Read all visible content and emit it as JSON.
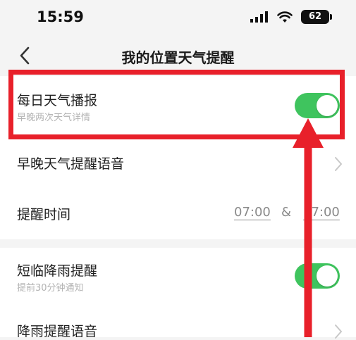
{
  "status_bar": {
    "time": "15:59",
    "battery": "62",
    "signal_icon": "signal-bars-icon",
    "wifi_icon": "wifi-icon"
  },
  "nav": {
    "title": "我的位置天气提醒",
    "back_icon": "chevron-left-icon"
  },
  "settings": {
    "daily_broadcast": {
      "title": "每日天气播报",
      "subtitle": "早晚两次天气详情",
      "enabled": true
    },
    "voice": {
      "title": "早晚天气提醒语音"
    },
    "reminder_time": {
      "title": "提醒时间",
      "morning": "07:00",
      "amp": "&",
      "evening": "17:00"
    },
    "rain_alert": {
      "title": "短临降雨提醒",
      "subtitle": "提前30分钟通知",
      "enabled": true
    },
    "rain_voice": {
      "title": "降雨提醒语音"
    }
  },
  "colors": {
    "toggle_on": "#3fc45e",
    "highlight": "#e8202a"
  }
}
